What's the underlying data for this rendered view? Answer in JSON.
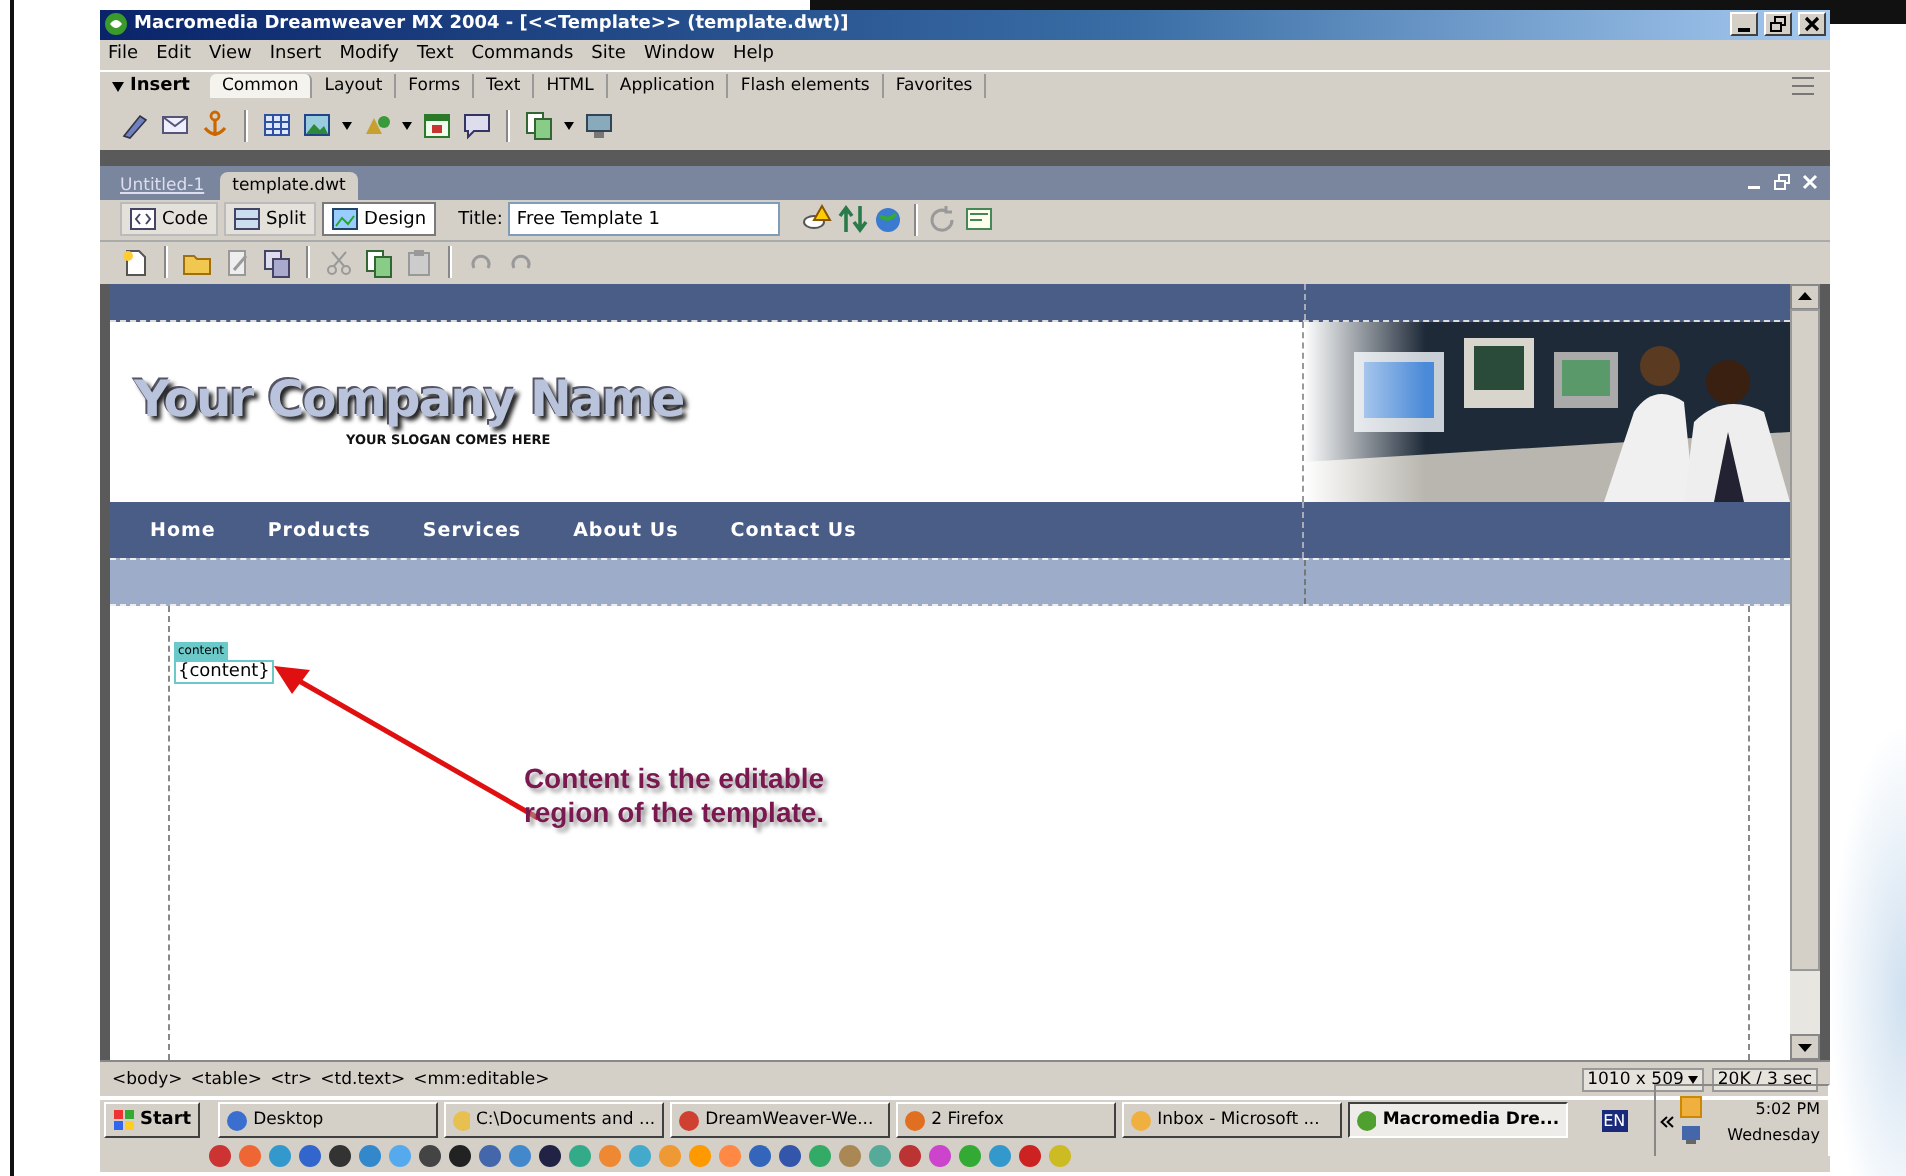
{
  "window": {
    "title": "Macromedia Dreamweaver MX 2004 - [<<Template>> (template.dwt)]"
  },
  "menu": [
    "File",
    "Edit",
    "View",
    "Insert",
    "Modify",
    "Text",
    "Commands",
    "Site",
    "Window",
    "Help"
  ],
  "insert_bar": {
    "label": "Insert",
    "expanded": true,
    "tabs": [
      {
        "label": "Common",
        "selected": true
      },
      {
        "label": "Layout",
        "selected": false
      },
      {
        "label": "Forms",
        "selected": false
      },
      {
        "label": "Text",
        "selected": false
      },
      {
        "label": "HTML",
        "selected": false
      },
      {
        "label": "Application",
        "selected": false
      },
      {
        "label": "Flash elements",
        "selected": false
      },
      {
        "label": "Favorites",
        "selected": false
      }
    ]
  },
  "document_tabs": [
    {
      "label": "Untitled-1",
      "selected": false
    },
    {
      "label": "template.dwt",
      "selected": true
    }
  ],
  "view_buttons": [
    {
      "kind": "code",
      "label": "Code",
      "selected": false
    },
    {
      "kind": "split",
      "label": "Split",
      "selected": false
    },
    {
      "kind": "design",
      "label": "Design",
      "selected": true
    }
  ],
  "title_field": {
    "label": "Title:",
    "value": "Free Template 1"
  },
  "page": {
    "logo": "Your Company Name",
    "slogan": "YOUR SLOGAN COMES HERE",
    "nav": [
      "Home",
      "Products",
      "Services",
      "About Us",
      "Contact Us"
    ],
    "region_tag": "content",
    "region_placeholder": "{content}"
  },
  "annotation": "Content is the editable region of the template.",
  "status_bar": {
    "tags": [
      "<body>",
      "<table>",
      "<tr>",
      "<td.text>",
      "<mm:editable>"
    ],
    "window_size": "1010 x 509",
    "download": "20K / 3 sec"
  },
  "taskbar": {
    "start": "Start",
    "tasks": [
      {
        "label": "Desktop",
        "selected": false,
        "color": "#3a6fd0"
      },
      {
        "label": "C:\\Documents and ...",
        "selected": false,
        "color": "#e8c050"
      },
      {
        "label": "DreamWeaver-We...",
        "selected": false,
        "color": "#d04030"
      },
      {
        "label": "2 Firefox",
        "selected": false,
        "color": "#e07020"
      },
      {
        "label": "Inbox - Microsoft ...",
        "selected": false,
        "color": "#f0b040"
      },
      {
        "label": "Macromedia Dre...",
        "selected": true,
        "color": "#50a030"
      }
    ],
    "language": "EN",
    "time": "5:02 PM",
    "day": "Wednesday"
  }
}
